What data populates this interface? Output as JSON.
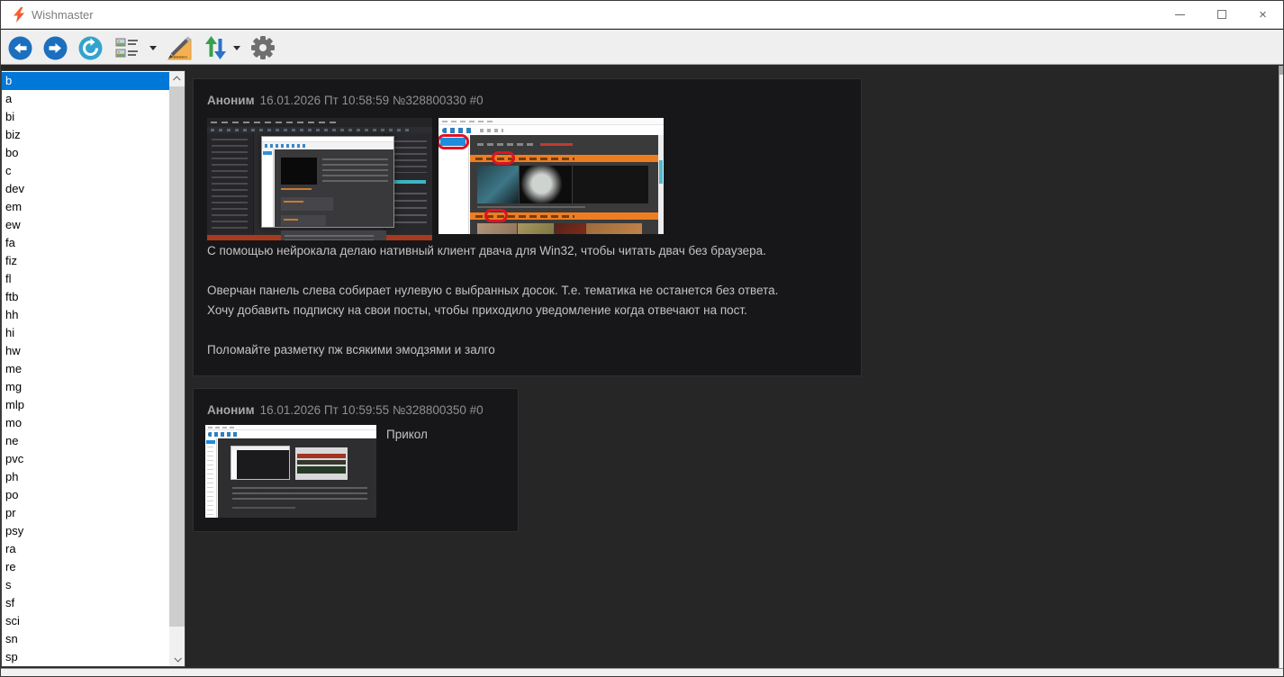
{
  "window": {
    "title": "Wishmaster",
    "app_icon": "lightning-bolt",
    "controls": {
      "minimize": "minimize",
      "maximize": "maximize",
      "close": "close"
    }
  },
  "toolbar": {
    "icons": [
      "back-arrow-circle",
      "forward-arrow-circle",
      "refresh-circle",
      "list-view",
      "ruler-pencil",
      "sort-up-down-arrows",
      "gear"
    ]
  },
  "sidebar": {
    "selected_index": 0,
    "items": [
      "b",
      "a",
      "bi",
      "biz",
      "bo",
      "c",
      "dev",
      "em",
      "ew",
      "fa",
      "fiz",
      "fl",
      "ftb",
      "hh",
      "hi",
      "hw",
      "me",
      "mg",
      "mlp",
      "mo",
      "ne",
      "pvc",
      "ph",
      "po",
      "pr",
      "psy",
      "ra",
      "re",
      "s",
      "sf",
      "sci",
      "sn",
      "sp"
    ]
  },
  "thread": {
    "posts": [
      {
        "author": "Аноним",
        "meta": "16.01.2026 Пт 10:58:59 №328800330 #0",
        "images": [
          "visual-studio-ide-screenshot",
          "wishmaster-overchan-screenshot"
        ],
        "paragraphs": [
          "С помощью нейрокала делаю нативный клиент двача для Win32, чтобы читать двач без браузера.",
          "",
          "Оверчан панель слева собирает нулевую с выбранных досок. Т.е. тематика не останется без ответа.",
          "Хочу добавить подписку на свои посты, чтобы приходило уведомление когда отвечают на пост.",
          "",
          "Поломайте разметку пж всякими эмодзями и залго"
        ]
      },
      {
        "author": "Аноним",
        "meta": "16.01.2026 Пт 10:59:55 №328800350 #0",
        "images": [
          "wishmaster-app-screenshot"
        ],
        "paragraphs": [
          "Прикол"
        ]
      }
    ]
  },
  "colors": {
    "selection_blue": "#0078d7",
    "content_background": "#262626",
    "card_background": "#171719",
    "toolbar_background": "#efefef",
    "thread_bar_orange": "#ee7d22",
    "annotation_red": "#dd1322",
    "app_icon_orange": "#f4511e"
  }
}
